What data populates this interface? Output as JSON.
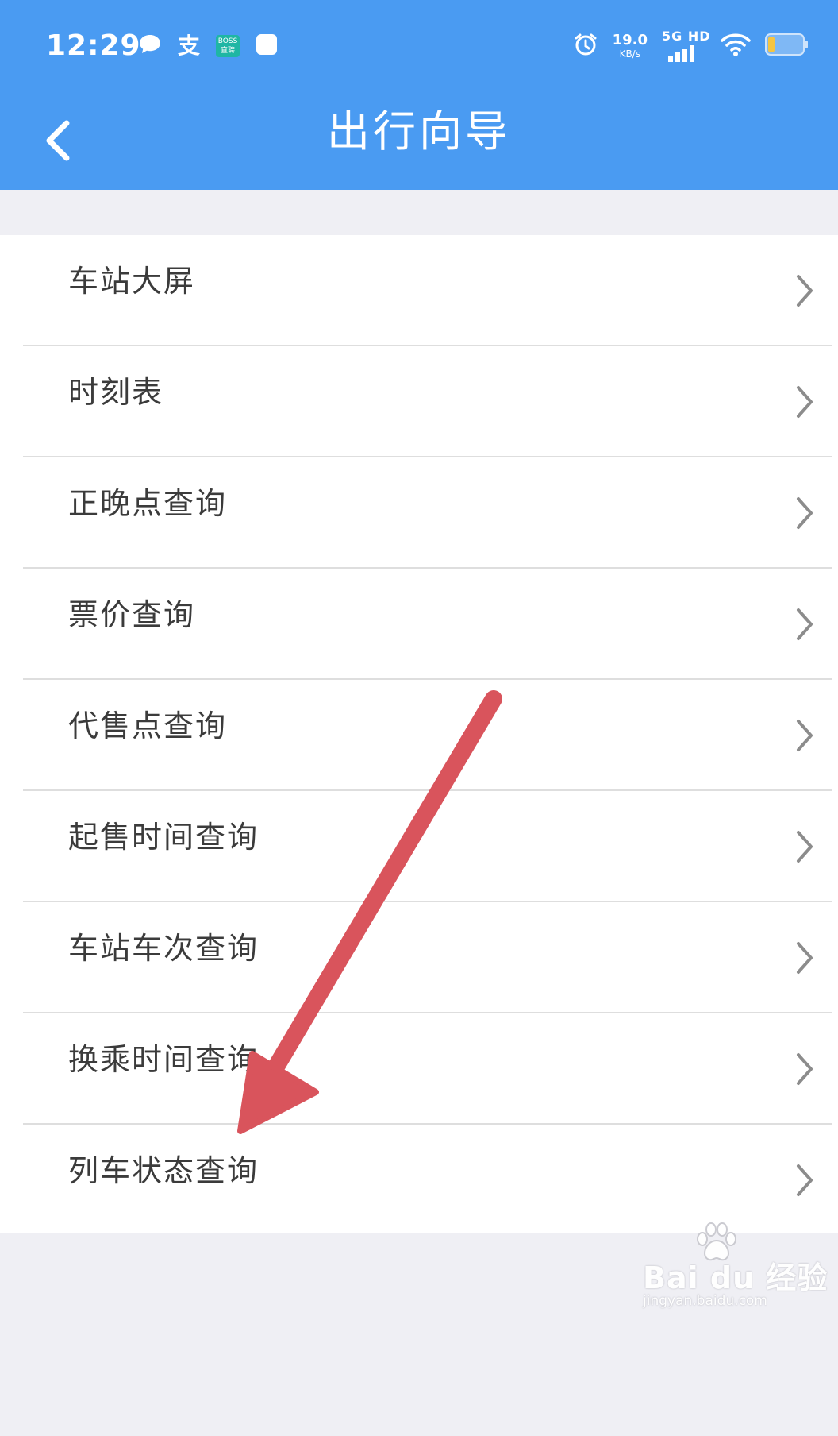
{
  "colors": {
    "header_bg": "#4a9bf2",
    "page_bg": "#efeff4",
    "list_bg": "#ffffff",
    "divider": "#dedede",
    "label_text": "#3b3b3b",
    "chevron": "#8c8c8c",
    "annotation_arrow": "#d9545c"
  },
  "status_bar": {
    "time": "12:29",
    "left_icons": [
      "message-icon",
      "alipay-icon",
      "boss-zhipin-icon",
      "square-app-icon"
    ],
    "boss_badge_top": "BOSS",
    "boss_badge_bottom": "直聘",
    "alipay_glyph": "支",
    "alarm_icon": "alarm-icon",
    "speed_value": "19.0",
    "speed_unit": "KB/s",
    "network_type": "5G HD",
    "signal_icon": "signal-icon",
    "wifi_icon": "wifi-icon",
    "battery_icon": "battery-icon"
  },
  "nav": {
    "back_icon": "back-chevron-icon",
    "title": "出行向导"
  },
  "menu": {
    "items": [
      {
        "label": "车站大屏"
      },
      {
        "label": "时刻表"
      },
      {
        "label": "正晚点查询"
      },
      {
        "label": "票价查询"
      },
      {
        "label": "代售点查询"
      },
      {
        "label": "起售时间查询"
      },
      {
        "label": "车站车次查询"
      },
      {
        "label": "换乘时间查询"
      },
      {
        "label": "列车状态查询"
      }
    ],
    "item_icon": "chevron-right-icon"
  },
  "annotation": {
    "type": "arrow",
    "points_to": "列车状态查询"
  },
  "watermark": {
    "brand": "Bai du 经验",
    "url": "jingyan.baidu.com"
  }
}
